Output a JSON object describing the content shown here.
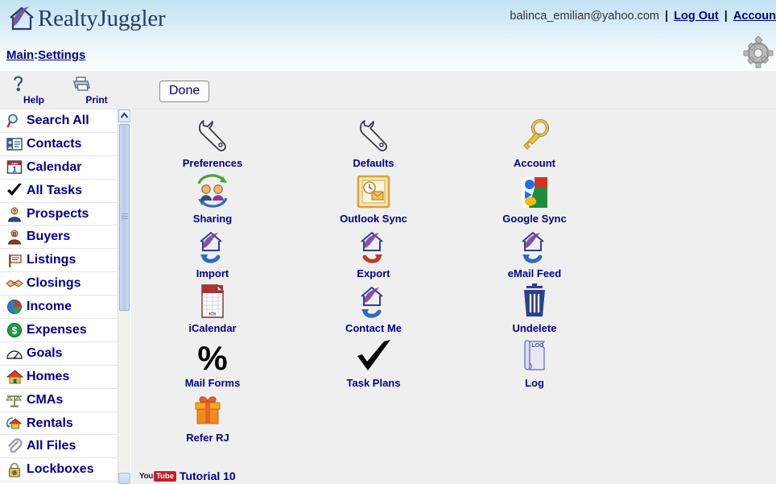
{
  "app": {
    "brand_name": "RealtyJuggler",
    "logo_icon": "house-swoosh-logo"
  },
  "header": {
    "email": "balinca_emilian@yahoo.com",
    "separator": "|",
    "logout_label": "Log Out",
    "account_label": "Accoun",
    "gear_icon": "gear-icon",
    "breadcrumb": {
      "main_label": "Main",
      "colon": ":",
      "current_label": "Settings"
    }
  },
  "toolbar": {
    "help_label": "Help",
    "help_icon": "question-mark-icon",
    "print_label": "Print",
    "print_icon": "printer-icon",
    "done_label": "Done"
  },
  "sidebar": {
    "items": [
      {
        "label": "Search All",
        "icon": "magnifier-icon"
      },
      {
        "label": "Contacts",
        "icon": "contact-card-icon"
      },
      {
        "label": "Calendar",
        "icon": "calendar-icon"
      },
      {
        "label": "All Tasks",
        "icon": "checkmark-icon"
      },
      {
        "label": "Prospects",
        "icon": "person-question-icon"
      },
      {
        "label": "Buyers",
        "icon": "person-b-icon"
      },
      {
        "label": "Listings",
        "icon": "for-sale-sign-icon"
      },
      {
        "label": "Closings",
        "icon": "handshake-icon"
      },
      {
        "label": "Income",
        "icon": "pie-chart-icon"
      },
      {
        "label": "Expenses",
        "icon": "dollar-coin-icon"
      },
      {
        "label": "Goals",
        "icon": "gauge-icon"
      },
      {
        "label": "Homes",
        "icon": "house-icon"
      },
      {
        "label": "CMAs",
        "icon": "scales-icon"
      },
      {
        "label": "Rentals",
        "icon": "house-recycle-icon"
      },
      {
        "label": "All Files",
        "icon": "paperclip-icon"
      },
      {
        "label": "Lockboxes",
        "icon": "padlock-icon"
      }
    ],
    "scrollbar": {
      "up_arrow_icon": "chevron-up-icon",
      "down_arrow_icon": "chevron-down-icon"
    }
  },
  "main": {
    "tiles": [
      {
        "label": "Preferences",
        "icon": "wrench-icon",
        "col": 0,
        "row": 0
      },
      {
        "label": "Defaults",
        "icon": "wrench-icon",
        "col": 1,
        "row": 0
      },
      {
        "label": "Account",
        "icon": "key-icon",
        "col": 2,
        "row": 0
      },
      {
        "label": "Sharing",
        "icon": "two-people-sync-icon",
        "col": 0,
        "row": 1
      },
      {
        "label": "Outlook Sync",
        "icon": "outlook-icon",
        "col": 1,
        "row": 1
      },
      {
        "label": "Google Sync",
        "icon": "google-g-icon",
        "col": 2,
        "row": 1
      },
      {
        "label": "Import",
        "icon": "house-arrow-in-icon",
        "col": 0,
        "row": 2
      },
      {
        "label": "Export",
        "icon": "house-arrow-out-icon",
        "col": 1,
        "row": 2
      },
      {
        "label": "eMail Feed",
        "icon": "house-arrow-in-icon",
        "col": 2,
        "row": 2
      },
      {
        "label": "iCalendar",
        "icon": "ics-file-icon",
        "col": 0,
        "row": 3
      },
      {
        "label": "Contact Me",
        "icon": "house-arrow-in-icon",
        "col": 1,
        "row": 3
      },
      {
        "label": "Undelete",
        "icon": "trash-can-icon",
        "col": 2,
        "row": 3
      },
      {
        "label": "Mail Forms",
        "icon": "percent-icon",
        "col": 0,
        "row": 4
      },
      {
        "label": "Task Plans",
        "icon": "checkmark-icon",
        "col": 1,
        "row": 4
      },
      {
        "label": "Log",
        "icon": "scroll-log-icon",
        "col": 2,
        "row": 4
      },
      {
        "label": "Refer RJ",
        "icon": "gift-box-icon",
        "col": 0,
        "row": 5
      }
    ],
    "tutorial": {
      "logo_icon": "youtube-icon",
      "logo_you": "You",
      "logo_tube": "Tube",
      "label": "Tutorial 10"
    }
  },
  "colors": {
    "link_blue": "#00008b",
    "header_gradient_top": "#c3e2f4",
    "content_gray": "#efefef",
    "scrollbar_blue": "#b3cce9"
  }
}
